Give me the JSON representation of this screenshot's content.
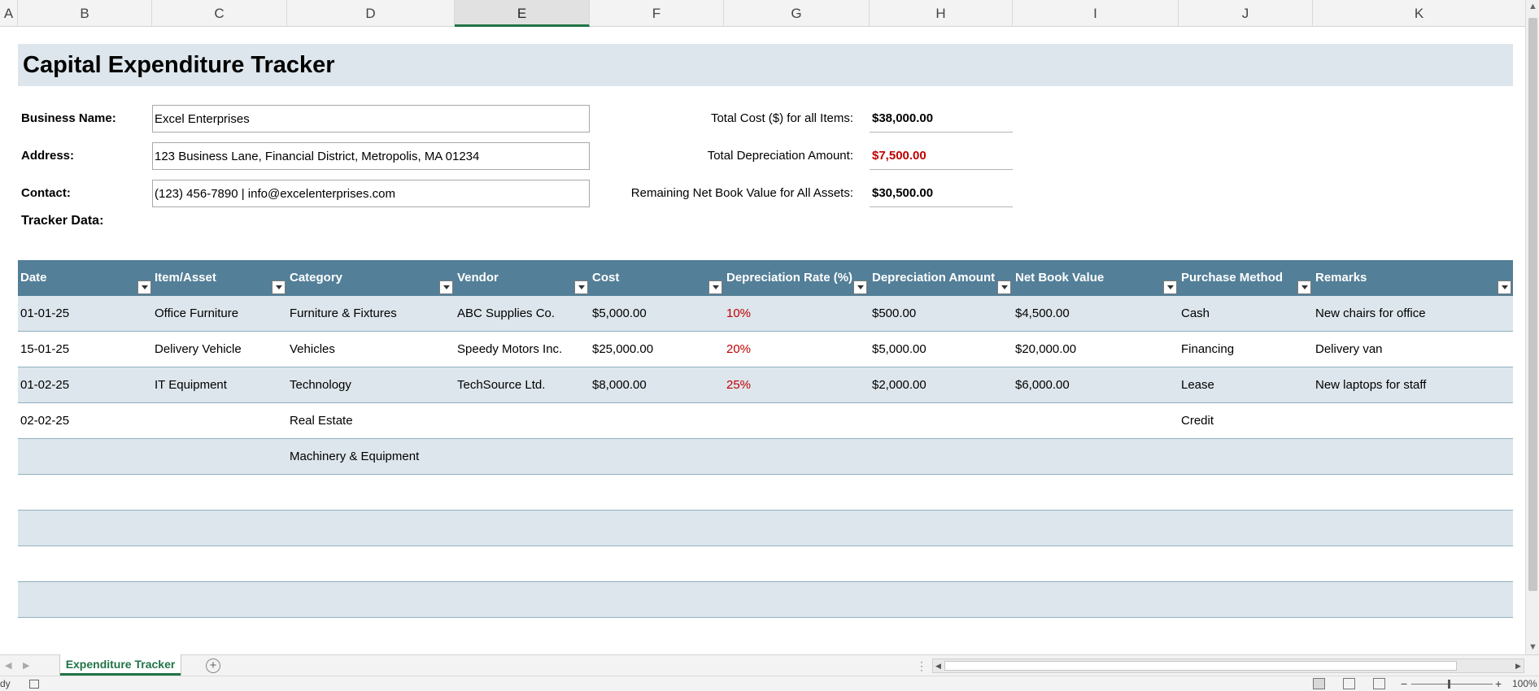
{
  "columns": [
    "A",
    "B",
    "C",
    "D",
    "E",
    "F",
    "G",
    "H",
    "I",
    "J",
    "K"
  ],
  "sheet": {
    "title": "Capital Expenditure Tracker",
    "business": {
      "name_label": "Business Name:",
      "name_value": "Excel Enterprises",
      "address_label": "Address:",
      "address_value": "123 Business Lane, Financial District, Metropolis, MA 01234",
      "contact_label": "Contact:",
      "contact_value": "(123) 456-7890 | info@excelenterprises.com"
    },
    "summary": {
      "total_cost_label": "Total Cost ($) for all Items:",
      "total_cost_value": "$38,000.00",
      "total_dep_label": "Total Depreciation Amount:",
      "total_dep_value": "$7,500.00",
      "remaining_label": "Remaining Net Book Value for All Assets:",
      "remaining_value": "$30,500.00"
    },
    "tracker_label": "Tracker Data:"
  },
  "table": {
    "headers": [
      "Date",
      "Item/Asset",
      "Category",
      "Vendor",
      "Cost",
      "Depreciation Rate (%)",
      "Depreciation Amount",
      "Net Book Value",
      "Purchase Method",
      "Remarks"
    ],
    "rows": [
      [
        "01-01-25",
        "Office Furniture",
        "Furniture & Fixtures",
        "ABC Supplies Co.",
        "$5,000.00",
        "10%",
        "$500.00",
        "$4,500.00",
        "Cash",
        "New chairs for office"
      ],
      [
        "15-01-25",
        "Delivery Vehicle",
        "Vehicles",
        "Speedy Motors Inc.",
        "$25,000.00",
        "20%",
        "$5,000.00",
        "$20,000.00",
        "Financing",
        "Delivery van"
      ],
      [
        "01-02-25",
        "IT Equipment",
        "Technology",
        "TechSource Ltd.",
        "$8,000.00",
        "25%",
        "$2,000.00",
        "$6,000.00",
        "Lease",
        "New laptops for staff"
      ],
      [
        "02-02-25",
        "",
        "Real Estate",
        "",
        "",
        "",
        "",
        "",
        "Credit",
        ""
      ],
      [
        "",
        "",
        "Machinery & Equipment",
        "",
        "",
        "",
        "",
        "",
        "",
        ""
      ],
      [
        "",
        "",
        "",
        "",
        "",
        "",
        "",
        "",
        "",
        ""
      ],
      [
        "",
        "",
        "",
        "",
        "",
        "",
        "",
        "",
        "",
        ""
      ],
      [
        "",
        "",
        "",
        "",
        "",
        "",
        "",
        "",
        "",
        ""
      ],
      [
        "",
        "",
        "",
        "",
        "",
        "",
        "",
        "",
        "",
        ""
      ],
      [
        "",
        "",
        "",
        "",
        "",
        "",
        "",
        "",
        "",
        ""
      ]
    ]
  },
  "tabs": {
    "active": "Expenditure Tracker",
    "add_icon": "plus-circle-icon"
  },
  "status": {
    "ready": "dy",
    "zoom": "100%"
  },
  "colors": {
    "header_band": "#537f98",
    "light_band": "#dde6ec",
    "negative_red": "#c00000",
    "excel_green": "#217346"
  }
}
